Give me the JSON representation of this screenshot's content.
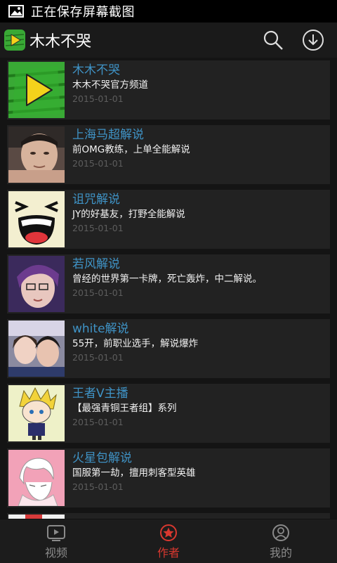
{
  "statusbar": {
    "text": "正在保存屏幕截图"
  },
  "appbar": {
    "title": "木木不哭"
  },
  "items": [
    {
      "name": "木木不哭",
      "desc": "木木不哭官方频道",
      "date": "2015-01-01",
      "avatar_icon": "green-play-logo"
    },
    {
      "name": "上海马超解说",
      "desc": "前OMG教练，上单全能解说",
      "date": "2015-01-01",
      "avatar_icon": "portrait-man"
    },
    {
      "name": "诅咒解说",
      "desc": "JY的好基友，打野全能解说",
      "date": "2015-01-01",
      "avatar_icon": "laughing-face"
    },
    {
      "name": "若风解说",
      "desc": "曾经的世界第一卡牌，死亡轰炸，中二解说。",
      "date": "2015-01-01",
      "avatar_icon": "portrait-purple-hair"
    },
    {
      "name": "white解说",
      "desc": "55开，前职业选手，解说爆炸",
      "date": "2015-01-01",
      "avatar_icon": "portrait-couple"
    },
    {
      "name": "王者V主播",
      "desc": "【最强青铜王者组】系列",
      "date": "2015-01-01",
      "avatar_icon": "anime-blonde-boy"
    },
    {
      "name": "火星包解说",
      "desc": "国服第一劫，擅用刺客型英雄",
      "date": "2015-01-01",
      "avatar_icon": "anime-pink-sketch"
    }
  ],
  "nav": [
    {
      "label": "视频",
      "icon": "video-icon",
      "active": false
    },
    {
      "label": "作者",
      "icon": "star-icon",
      "active": true
    },
    {
      "label": "我的",
      "icon": "person-icon",
      "active": false
    }
  ],
  "colors": {
    "accent": "#d9382f",
    "link": "#3f93c6",
    "background": "#141414",
    "card": "#222222"
  }
}
